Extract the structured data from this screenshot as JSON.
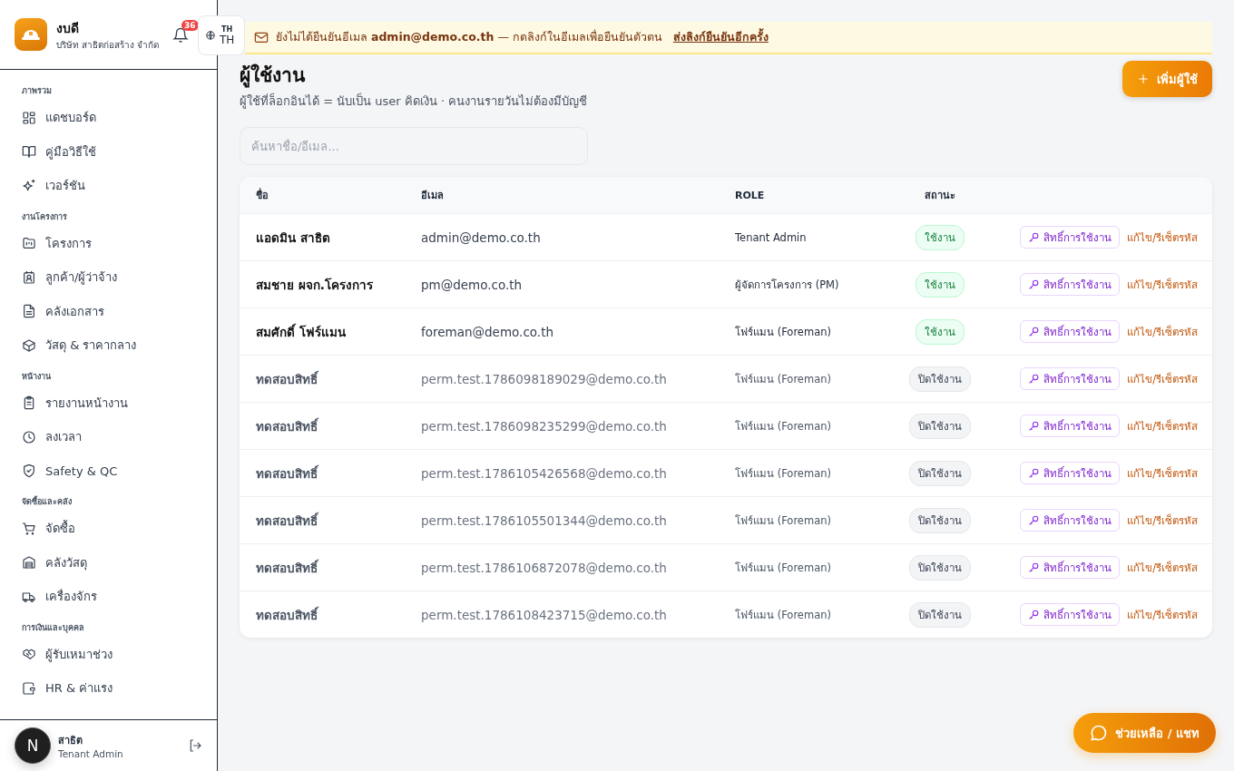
{
  "sidebar": {
    "app_name": "งบดี",
    "company": "บริษัท สาธิตก่อสร้าง จำกัด",
    "notification_count": "36",
    "language": {
      "code": "TH",
      "label": "TH"
    },
    "sections": [
      {
        "title": "ภาพรวม",
        "items": [
          {
            "label": "แดชบอร์ด",
            "kind": "grid"
          },
          {
            "label": "คู่มือวิธีใช้",
            "kind": "book"
          },
          {
            "label": "เวอร์ชัน",
            "kind": "sparkle"
          }
        ]
      },
      {
        "title": "งานโครงการ",
        "items": [
          {
            "label": "โครงการ",
            "kind": "folder"
          },
          {
            "label": "ลูกค้า/ผู้ว่าจ้าง",
            "kind": "contact"
          },
          {
            "label": "คลังเอกสาร",
            "kind": "doc"
          },
          {
            "label": "วัสดุ & ราคากลาง",
            "kind": "box"
          }
        ]
      },
      {
        "title": "หน้างาน",
        "items": [
          {
            "label": "รายงานหน้างาน",
            "kind": "clipboard"
          },
          {
            "label": "ลงเวลา",
            "kind": "clock"
          },
          {
            "label": "Safety & QC",
            "kind": "shield"
          }
        ]
      },
      {
        "title": "จัดซื้อและคลัง",
        "items": [
          {
            "label": "จัดซื้อ",
            "kind": "cart"
          },
          {
            "label": "คลังวัสดุ",
            "kind": "warehouse"
          },
          {
            "label": "เครื่องจักร",
            "kind": "truck"
          }
        ]
      },
      {
        "title": "การเงินและบุคคล",
        "items": [
          {
            "label": "ผู้รับเหมาช่วง",
            "kind": "handshake"
          },
          {
            "label": "HR & ค่าแรง",
            "kind": "wallet"
          }
        ]
      }
    ],
    "user": {
      "name": "สาธิต",
      "role": "Tenant Admin",
      "avatar": "N"
    }
  },
  "banner": {
    "text": "ยังไม่ได้ยืนยันอีเมล **admin@demo.co.th** — กดลิงก์ในอีเมลเพื่อยืนยันตัวตน",
    "link": "ส่งลิงก์ยืนยันอีกครั้ง"
  },
  "page": {
    "title": "ผู้ใช้งาน",
    "subtitle": "ผู้ใช้ที่ล็อกอินได้ = นับเป็น user คิดเงิน · คนงานรายวันไม่ต้องมีบัญชี",
    "add_button": "เพิ่มผู้ใช้",
    "search": {
      "placeholder": "ค้นหาชื่อ/อีเมล..."
    }
  },
  "table": {
    "columns": [
      "ชื่อ",
      "อีเมล",
      "ROLE",
      "สถานะ"
    ],
    "rows": [
      {
        "name": "แอดมิน สาธิต",
        "email": "admin@demo.co.th",
        "role": "Tenant Admin",
        "status": "ใช้งาน",
        "active": true,
        "permissions": "สิทธิ์การใช้งาน",
        "edit": "แก้ไข/รีเซ็ตรหัส"
      },
      {
        "name": "สมชาย ผจก.โครงการ",
        "email": "pm@demo.co.th",
        "role": "ผู้จัดการโครงการ (PM)",
        "status": "ใช้งาน",
        "active": true,
        "permissions": "สิทธิ์การใช้งาน",
        "edit": "แก้ไข/รีเซ็ตรหัส"
      },
      {
        "name": "สมศักดิ์ โฟร์แมน",
        "email": "foreman@demo.co.th",
        "role": "โฟร์แมน (Foreman)",
        "status": "ใช้งาน",
        "active": true,
        "permissions": "สิทธิ์การใช้งาน",
        "edit": "แก้ไข/รีเซ็ตรหัส"
      },
      {
        "name": "ทดสอบสิทธิ์",
        "email": "perm.test.1786098189029@demo.co.th",
        "role": "โฟร์แมน (Foreman)",
        "status": "ปิดใช้งาน",
        "active": false,
        "permissions": "สิทธิ์การใช้งาน",
        "edit": "แก้ไข/รีเซ็ตรหัส"
      },
      {
        "name": "ทดสอบสิทธิ์",
        "email": "perm.test.1786098235299@demo.co.th",
        "role": "โฟร์แมน (Foreman)",
        "status": "ปิดใช้งาน",
        "active": false,
        "permissions": "สิทธิ์การใช้งาน",
        "edit": "แก้ไข/รีเซ็ตรหัส"
      },
      {
        "name": "ทดสอบสิทธิ์",
        "email": "perm.test.1786105426568@demo.co.th",
        "role": "โฟร์แมน (Foreman)",
        "status": "ปิดใช้งาน",
        "active": false,
        "permissions": "สิทธิ์การใช้งาน",
        "edit": "แก้ไข/รีเซ็ตรหัส"
      },
      {
        "name": "ทดสอบสิทธิ์",
        "email": "perm.test.1786105501344@demo.co.th",
        "role": "โฟร์แมน (Foreman)",
        "status": "ปิดใช้งาน",
        "active": false,
        "permissions": "สิทธิ์การใช้งาน",
        "edit": "แก้ไข/รีเซ็ตรหัส"
      },
      {
        "name": "ทดสอบสิทธิ์",
        "email": "perm.test.1786106872078@demo.co.th",
        "role": "โฟร์แมน (Foreman)",
        "status": "ปิดใช้งาน",
        "active": false,
        "permissions": "สิทธิ์การใช้งาน",
        "edit": "แก้ไข/รีเซ็ตรหัส"
      },
      {
        "name": "ทดสอบสิทธิ์",
        "email": "perm.test.1786108423715@demo.co.th",
        "role": "โฟร์แมน (Foreman)",
        "status": "ปิดใช้งาน",
        "active": false,
        "permissions": "สิทธิ์การใช้งาน",
        "edit": "แก้ไข/รีเซ็ตรหัส"
      }
    ]
  },
  "help_button": "ช่วยเหลือ / แชท"
}
